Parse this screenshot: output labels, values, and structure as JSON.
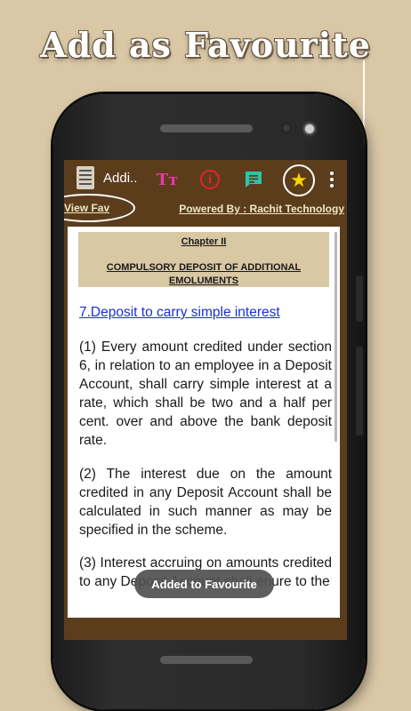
{
  "headline": "Add as Favourite",
  "toolbar": {
    "app_title": "Addi..",
    "font_icon_glyph": "Tт",
    "info_icon_glyph": "i",
    "star_icon_glyph": "★",
    "icons": [
      "font-size-icon",
      "info-icon",
      "chat-icon",
      "star-icon",
      "more-vert-icon"
    ]
  },
  "links": {
    "view_fav": "View Fav",
    "powered_by": "Powered By : Rachit Technology"
  },
  "chapter": {
    "number": "Chapter II",
    "title": "COMPULSORY DEPOSIT OF ADDITIONAL EMOLUMENTS"
  },
  "section_link": "7.Deposit to carry simple interest",
  "paragraphs": [
    "(1) Every amount credited under section 6, in relation to an employee in a Deposit Account, shall carry simple interest at a rate, which shall be two and a half per cent. over and above the bank deposit rate.",
    "(2) The interest due on the amount credited in any Deposit Account shall be calculated in such manner as may be specified in the scheme.",
    "(3) Interest accruing on amounts credited to any Deposit Account shall enure to the"
  ],
  "toast": "Added to Favourite",
  "colors": {
    "background": "#d9c7a6",
    "app_bar": "#5b3d1c",
    "link": "#1a2ed8",
    "star": "#ffd400"
  }
}
